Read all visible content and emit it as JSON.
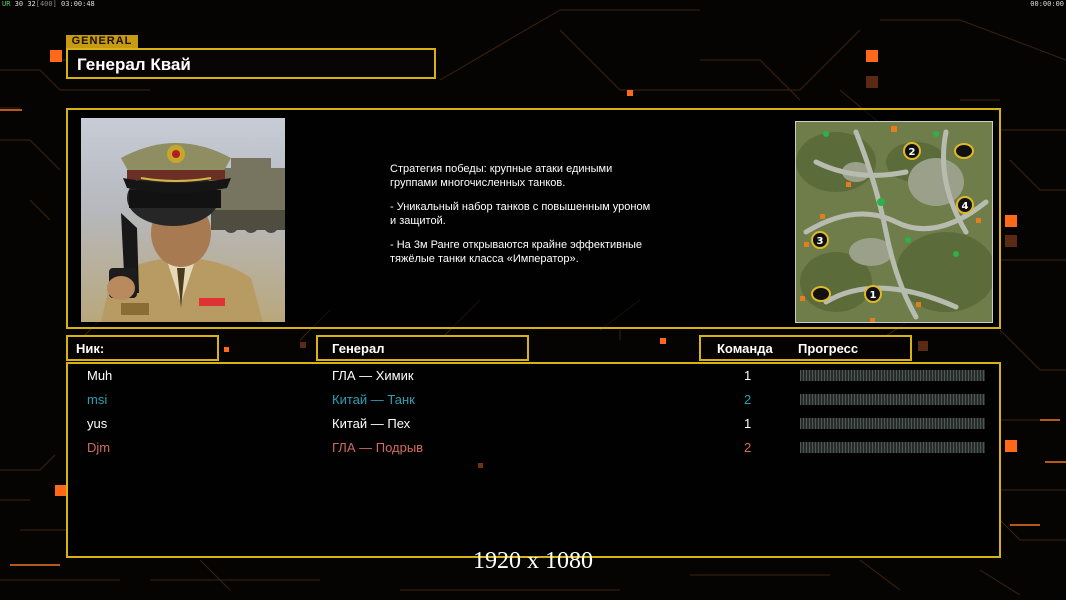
{
  "hud": {
    "prefix": "UR",
    "fps": "30",
    "limit": "32",
    "slot": "[400]",
    "time": "03:00:48",
    "clock": "00:00:00"
  },
  "section_tag": "GENERAL",
  "general": {
    "name": "Генерал Квай",
    "description": [
      "Стратегия победы: крупные атаки едиными\n группами многочисленных танков.",
      "- Уникальный набор танков с повышенным уроном\n и защитой.",
      "- На 3м Ранге открываются крайне эффективные\n тяжёлые танки класса «Император»."
    ]
  },
  "minimap": {
    "start_positions": [
      "1",
      "2",
      "3",
      "4"
    ]
  },
  "table": {
    "headers": {
      "nick": "Ник:",
      "general": "Генерал",
      "team": "Команда",
      "progress": "Прогресс"
    },
    "rows": [
      {
        "nick": "Muh",
        "general": "ГЛА — Химик",
        "team": "1",
        "color": "#ffffff",
        "progress": 0
      },
      {
        "nick": "msi",
        "general": "Китай — Танк",
        "team": "2",
        "color": "#2aa0b3",
        "progress": 0
      },
      {
        "nick": "yus",
        "general": "Китай — Пех",
        "team": "1",
        "color": "#ffffff",
        "progress": 0
      },
      {
        "nick": "Djm",
        "general": "ГЛА — Подрыв",
        "team": "2",
        "color": "#d06c5c",
        "progress": 0
      }
    ]
  },
  "resolution": "1920 x 1080",
  "colors": {
    "accent": "#d6b30f",
    "orange": "#ff6a00",
    "progress_fill": "#79d34a"
  }
}
